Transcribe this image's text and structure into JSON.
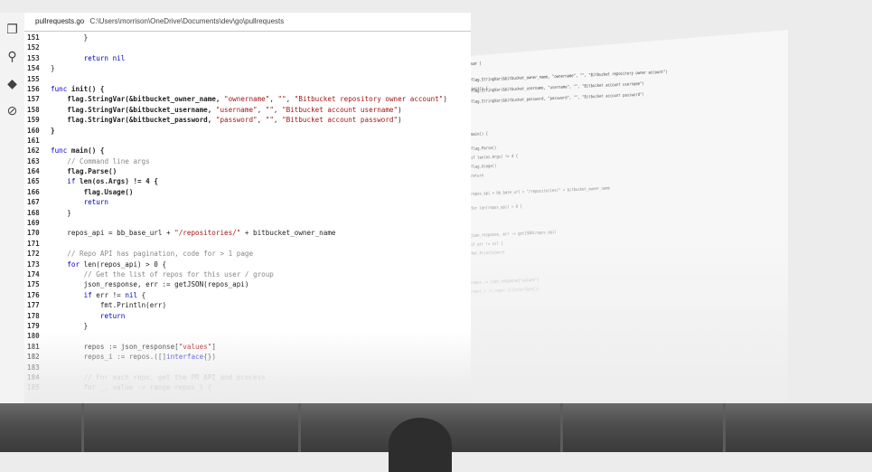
{
  "title_bar": {
    "filename": "pullrequests.go",
    "path": "C:\\Users\\morrison\\OneDrive\\Documents\\dev\\go\\pullrequests"
  },
  "activity_bar": [
    {
      "name": "explorer-icon",
      "glyph": "❐"
    },
    {
      "name": "search-icon",
      "glyph": "⚲"
    },
    {
      "name": "source-control-icon",
      "glyph": "◆"
    },
    {
      "name": "debug-icon",
      "glyph": "⊘"
    }
  ],
  "code_lines": [
    {
      "n": "151",
      "segments": [
        {
          "t": "        }",
          "c": "txt"
        }
      ]
    },
    {
      "n": "152",
      "segments": [
        {
          "t": "",
          "c": "txt"
        }
      ]
    },
    {
      "n": "153",
      "segments": [
        {
          "t": "        ",
          "c": "txt"
        },
        {
          "t": "return",
          "c": "kw"
        },
        {
          "t": " nil",
          "c": "kw"
        }
      ]
    },
    {
      "n": "154",
      "segments": [
        {
          "t": "}",
          "c": "txt"
        }
      ]
    },
    {
      "n": "155",
      "segments": [
        {
          "t": "",
          "c": "txt"
        }
      ]
    },
    {
      "n": "156",
      "segments": [
        {
          "t": "func",
          "c": "kw"
        },
        {
          "t": " init() {",
          "c": "txt bold"
        }
      ]
    },
    {
      "n": "157",
      "segments": [
        {
          "t": "    flag.StringVar(&bitbucket_owner_name, ",
          "c": "txt bold"
        },
        {
          "t": "\"ownername\"",
          "c": "str"
        },
        {
          "t": ", ",
          "c": "txt"
        },
        {
          "t": "\"\"",
          "c": "str"
        },
        {
          "t": ", ",
          "c": "txt"
        },
        {
          "t": "\"Bitbucket repository owner account\"",
          "c": "str"
        },
        {
          "t": ")",
          "c": "txt"
        }
      ]
    },
    {
      "n": "158",
      "segments": [
        {
          "t": "    flag.StringVar(&bitbucket_username, ",
          "c": "txt bold"
        },
        {
          "t": "\"username\"",
          "c": "str"
        },
        {
          "t": ", ",
          "c": "txt"
        },
        {
          "t": "\"\"",
          "c": "str"
        },
        {
          "t": ", ",
          "c": "txt"
        },
        {
          "t": "\"Bitbucket account username\"",
          "c": "str"
        },
        {
          "t": ")",
          "c": "txt"
        }
      ]
    },
    {
      "n": "159",
      "segments": [
        {
          "t": "    flag.StringVar(&bitbucket_password, ",
          "c": "txt bold"
        },
        {
          "t": "\"password\"",
          "c": "str"
        },
        {
          "t": ", ",
          "c": "txt"
        },
        {
          "t": "\"\"",
          "c": "str"
        },
        {
          "t": ", ",
          "c": "txt"
        },
        {
          "t": "\"Bitbucket account password\"",
          "c": "str"
        },
        {
          "t": ")",
          "c": "txt"
        }
      ]
    },
    {
      "n": "160",
      "segments": [
        {
          "t": "}",
          "c": "txt bold"
        }
      ]
    },
    {
      "n": "161",
      "segments": [
        {
          "t": "",
          "c": "txt"
        }
      ]
    },
    {
      "n": "162",
      "segments": [
        {
          "t": "func",
          "c": "kw"
        },
        {
          "t": " main() {",
          "c": "txt bold"
        }
      ]
    },
    {
      "n": "163",
      "segments": [
        {
          "t": "    ",
          "c": "txt"
        },
        {
          "t": "// Command line args",
          "c": "cm"
        }
      ]
    },
    {
      "n": "164",
      "segments": [
        {
          "t": "    flag.Parse()",
          "c": "txt bold"
        }
      ]
    },
    {
      "n": "165",
      "segments": [
        {
          "t": "    ",
          "c": "txt"
        },
        {
          "t": "if",
          "c": "kw"
        },
        {
          "t": " len(os.Args) != 4 {",
          "c": "txt bold"
        }
      ]
    },
    {
      "n": "166",
      "segments": [
        {
          "t": "        flag.Usage()",
          "c": "txt bold"
        }
      ]
    },
    {
      "n": "167",
      "segments": [
        {
          "t": "        ",
          "c": "txt"
        },
        {
          "t": "return",
          "c": "kw"
        }
      ]
    },
    {
      "n": "168",
      "segments": [
        {
          "t": "    }",
          "c": "txt"
        }
      ]
    },
    {
      "n": "169",
      "segments": [
        {
          "t": "",
          "c": "txt"
        }
      ]
    },
    {
      "n": "170",
      "segments": [
        {
          "t": "    repos_api = bb_base_url + ",
          "c": "txt"
        },
        {
          "t": "\"/repositories/\"",
          "c": "str"
        },
        {
          "t": " + bitbucket_owner_name",
          "c": "txt"
        }
      ]
    },
    {
      "n": "171",
      "segments": [
        {
          "t": "",
          "c": "txt"
        }
      ]
    },
    {
      "n": "172",
      "segments": [
        {
          "t": "    ",
          "c": "txt"
        },
        {
          "t": "// Repo API has pagination, code for > 1 page",
          "c": "cm"
        }
      ]
    },
    {
      "n": "173",
      "segments": [
        {
          "t": "    ",
          "c": "txt"
        },
        {
          "t": "for",
          "c": "kw"
        },
        {
          "t": " len(repos_api) > 0 {",
          "c": "txt"
        }
      ]
    },
    {
      "n": "174",
      "segments": [
        {
          "t": "        ",
          "c": "txt"
        },
        {
          "t": "// Get the list of repos for this user / group",
          "c": "cm"
        }
      ]
    },
    {
      "n": "175",
      "segments": [
        {
          "t": "        json_response, err := getJSON(repos_api)",
          "c": "txt"
        }
      ]
    },
    {
      "n": "176",
      "segments": [
        {
          "t": "        ",
          "c": "txt"
        },
        {
          "t": "if",
          "c": "kw"
        },
        {
          "t": " err != ",
          "c": "txt"
        },
        {
          "t": "nil",
          "c": "kw"
        },
        {
          "t": " {",
          "c": "txt"
        }
      ]
    },
    {
      "n": "177",
      "segments": [
        {
          "t": "            fmt.Println(err)",
          "c": "txt"
        }
      ]
    },
    {
      "n": "178",
      "segments": [
        {
          "t": "            ",
          "c": "txt"
        },
        {
          "t": "return",
          "c": "kw"
        }
      ]
    },
    {
      "n": "179",
      "segments": [
        {
          "t": "        }",
          "c": "txt"
        }
      ]
    },
    {
      "n": "180",
      "segments": [
        {
          "t": "",
          "c": "txt"
        }
      ]
    },
    {
      "n": "181",
      "segments": [
        {
          "t": "        repos := json_response[",
          "c": "txt"
        },
        {
          "t": "\"values\"",
          "c": "str"
        },
        {
          "t": "]",
          "c": "txt"
        }
      ]
    },
    {
      "n": "182",
      "segments": [
        {
          "t": "        repos_i := repos.([]",
          "c": "txt"
        },
        {
          "t": "interface",
          "c": "kw"
        },
        {
          "t": "{})",
          "c": "txt"
        }
      ]
    },
    {
      "n": "183",
      "segments": [
        {
          "t": "",
          "c": "txt"
        }
      ]
    },
    {
      "n": "184",
      "segments": [
        {
          "t": "        ",
          "c": "txt"
        },
        {
          "t": "// For each repo, get the PR API and process",
          "c": "cm"
        }
      ]
    },
    {
      "n": "185",
      "segments": [
        {
          "t": "        for _, value := range repos_i {",
          "c": "txt"
        }
      ]
    }
  ],
  "perspective_code": [
    "var (",
    "init() {",
    "flag.StringVar(&bitbucket_owner_name, \"ownername\", \"\", \"Bitbucket repository owner account\")",
    "flag.StringVar(&bitbucket_username, \"username\", \"\", \"Bitbucket account username\")",
    "flag.StringVar(&bitbucket_password, \"password\", \"\", \"Bitbucket account password\")",
    "main() {",
    "flag.Parse()",
    "if len(os.Args) != 4 {",
    "flag.Usage()",
    "return",
    "repos_api = bb_base_url + \"/repositories/\" + bitbucket_owner_name",
    "for len(repos_api) > 0 {",
    "json_response, err := getJSON(repos_api)",
    "if err != nil {",
    "fmt.Println(err)",
    "repos := json_response[\"values\"]",
    "repos_i := repos.([]interface{})"
  ]
}
